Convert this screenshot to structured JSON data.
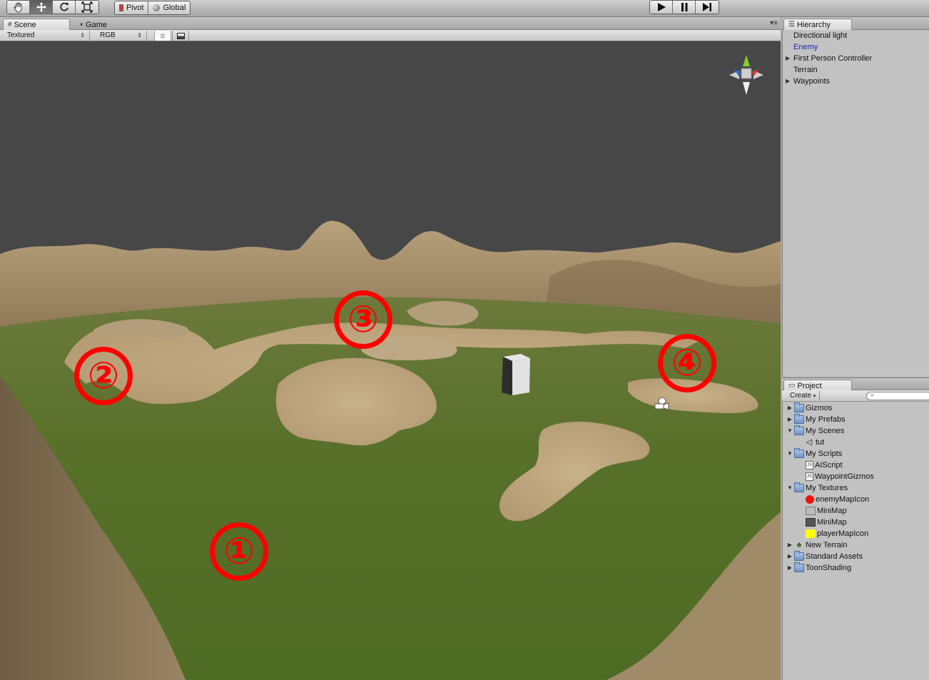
{
  "toolbar": {
    "transform_tools": [
      {
        "name": "hand-icon"
      },
      {
        "name": "move-icon"
      },
      {
        "name": "rotate-icon"
      },
      {
        "name": "scale-icon"
      }
    ],
    "pivot_label": "Pivot",
    "global_label": "Global",
    "play_controls": [
      {
        "name": "play-icon"
      },
      {
        "name": "pause-icon"
      },
      {
        "name": "step-icon"
      }
    ]
  },
  "scene_panel": {
    "tabs": [
      {
        "label": "Scene",
        "icon": "grid-icon",
        "active": true
      },
      {
        "label": "Game",
        "icon": "pacman-icon",
        "active": false
      }
    ],
    "render_mode": "Textured",
    "color_mode": "RGB",
    "lighting_toggle_icon": "sun-icon",
    "overlay_toggle_icon": "image-icon",
    "markers": [
      "①",
      "②",
      "③",
      "④"
    ]
  },
  "hierarchy": {
    "tab_label": "Hierarchy",
    "items": [
      {
        "label": "Directional light",
        "expandable": false,
        "selected": false
      },
      {
        "label": "Enemy",
        "expandable": false,
        "selected": true
      },
      {
        "label": "First Person Controller",
        "expandable": true,
        "selected": false
      },
      {
        "label": "Terrain",
        "expandable": false,
        "selected": false
      },
      {
        "label": "Waypoints",
        "expandable": true,
        "selected": false
      }
    ]
  },
  "project": {
    "tab_label": "Project",
    "create_label": "Create",
    "items": [
      {
        "label": "Gizmos",
        "icon": "folder-icon",
        "depth": 0,
        "tri": "▶"
      },
      {
        "label": "My Prefabs",
        "icon": "folder-icon",
        "depth": 0,
        "tri": "▶"
      },
      {
        "label": "My Scenes",
        "icon": "folder-icon",
        "depth": 0,
        "tri": "▼"
      },
      {
        "label": "tut",
        "icon": "unity-scene-icon",
        "depth": 1,
        "tri": ""
      },
      {
        "label": "My Scripts",
        "icon": "folder-icon",
        "depth": 0,
        "tri": "▼"
      },
      {
        "label": "AIScript",
        "icon": "script-icon",
        "depth": 1,
        "tri": ""
      },
      {
        "label": "WaypointGizmos",
        "icon": "script-icon",
        "depth": 1,
        "tri": ""
      },
      {
        "label": "My Textures",
        "icon": "folder-icon",
        "depth": 0,
        "tri": "▼"
      },
      {
        "label": "enemyMapIcon",
        "icon": "red-texture-icon",
        "depth": 1,
        "tri": ""
      },
      {
        "label": "MiniMap",
        "icon": "grey-texture-icon",
        "depth": 1,
        "tri": ""
      },
      {
        "label": "MiniMap",
        "icon": "dark-texture-icon",
        "depth": 1,
        "tri": ""
      },
      {
        "label": "playerMapIcon",
        "icon": "yellow-texture-icon",
        "depth": 1,
        "tri": ""
      },
      {
        "label": "New Terrain",
        "icon": "terrain-icon",
        "depth": 0,
        "tri": "▶"
      },
      {
        "label": "Standard Assets",
        "icon": "folder-icon",
        "depth": 0,
        "tri": "▶"
      },
      {
        "label": "ToonShading",
        "icon": "folder-icon",
        "depth": 0,
        "tri": "▶"
      }
    ]
  }
}
